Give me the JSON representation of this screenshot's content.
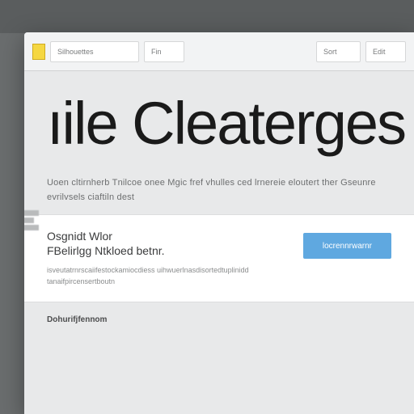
{
  "toolbar": {
    "field1": "Silhouettes",
    "field2": "Fin",
    "field3": "Sort",
    "field4": "Edit"
  },
  "hero": "ıile Cleaterges",
  "paragraph": "Uoen cltirnherb Tnilcoe onee Mgic fref vhulles ced lrnereie eloutert ther Gseunre evrilvsels ciaftiln dest",
  "card": {
    "title": "Osgnidt Wlor",
    "subtitle": "FBelirlgg Ntkloed betnr.",
    "desc": "isveutatrnrscaiifestockamiocdiess uihwuerlnasdisortedtuplinidd tanaifpircensertboutn",
    "cta": "locrennrwarnr"
  },
  "footer": "Dohurifjfennom"
}
